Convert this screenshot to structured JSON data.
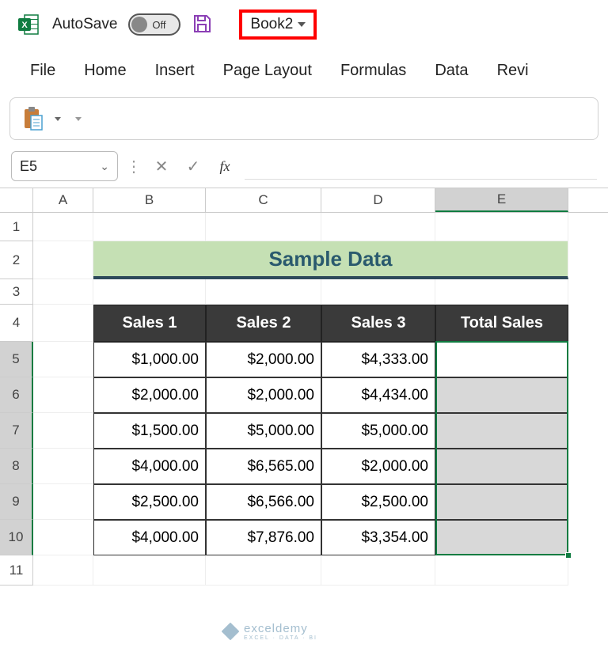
{
  "titlebar": {
    "autosave_label": "AutoSave",
    "autosave_state": "Off",
    "filename": "Book2"
  },
  "ribbon": {
    "tabs": [
      "File",
      "Home",
      "Insert",
      "Page Layout",
      "Formulas",
      "Data",
      "Revi"
    ]
  },
  "formula_bar": {
    "name_box": "E5",
    "formula": ""
  },
  "columns": [
    "A",
    "B",
    "C",
    "D",
    "E"
  ],
  "rows": [
    "1",
    "2",
    "3",
    "4",
    "5",
    "6",
    "7",
    "8",
    "9",
    "10",
    "11"
  ],
  "selected_column": "E",
  "selected_rows": [
    "5",
    "6",
    "7",
    "8",
    "9",
    "10"
  ],
  "sheet": {
    "title": "Sample Data",
    "headers": [
      "Sales 1",
      "Sales 2",
      "Sales 3",
      "Total Sales"
    ],
    "data": [
      {
        "s1": "$1,000.00",
        "s2": "$2,000.00",
        "s3": "$4,333.00",
        "t": ""
      },
      {
        "s1": "$2,000.00",
        "s2": "$2,000.00",
        "s3": "$4,434.00",
        "t": ""
      },
      {
        "s1": "$1,500.00",
        "s2": "$5,000.00",
        "s3": "$5,000.00",
        "t": ""
      },
      {
        "s1": "$4,000.00",
        "s2": "$6,565.00",
        "s3": "$2,000.00",
        "t": ""
      },
      {
        "s1": "$2,500.00",
        "s2": "$6,566.00",
        "s3": "$2,500.00",
        "t": ""
      },
      {
        "s1": "$4,000.00",
        "s2": "$7,876.00",
        "s3": "$3,354.00",
        "t": ""
      }
    ]
  },
  "watermark": {
    "brand": "exceldemy",
    "tagline": "EXCEL · DATA · BI"
  }
}
